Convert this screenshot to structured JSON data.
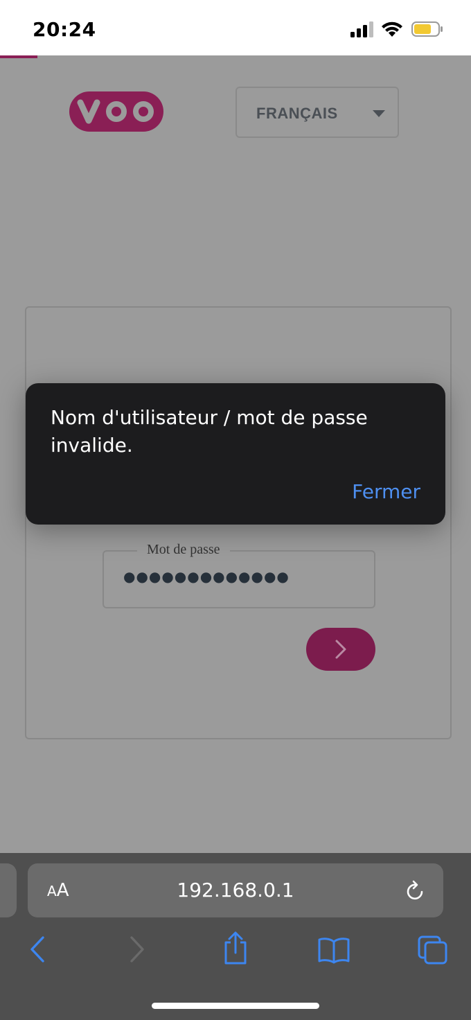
{
  "status_bar": {
    "time": "20:24"
  },
  "header": {
    "logo_icon": "voo-logo-icon",
    "language_select": {
      "selected": "FRANÇAIS"
    }
  },
  "login": {
    "password_label": "Mot de passe",
    "password_value": "●●●●●●●●●●●●●",
    "submit_icon": "chevron-right-icon"
  },
  "dialog": {
    "message": "Nom d'utilisateur / mot de passe invalide.",
    "close_label": "Fermer"
  },
  "browser": {
    "aa_small": "A",
    "aa_large": "A",
    "url": "192.168.0.1",
    "icons": [
      "back-icon",
      "forward-icon",
      "share-icon",
      "bookmarks-icon",
      "tabs-icon",
      "reload-icon"
    ]
  },
  "colors": {
    "brand": "#8a1f55",
    "overlay_background": "#9b9b9b",
    "dialog_background": "#1c1c1e",
    "link_blue": "#4e8ff0"
  }
}
